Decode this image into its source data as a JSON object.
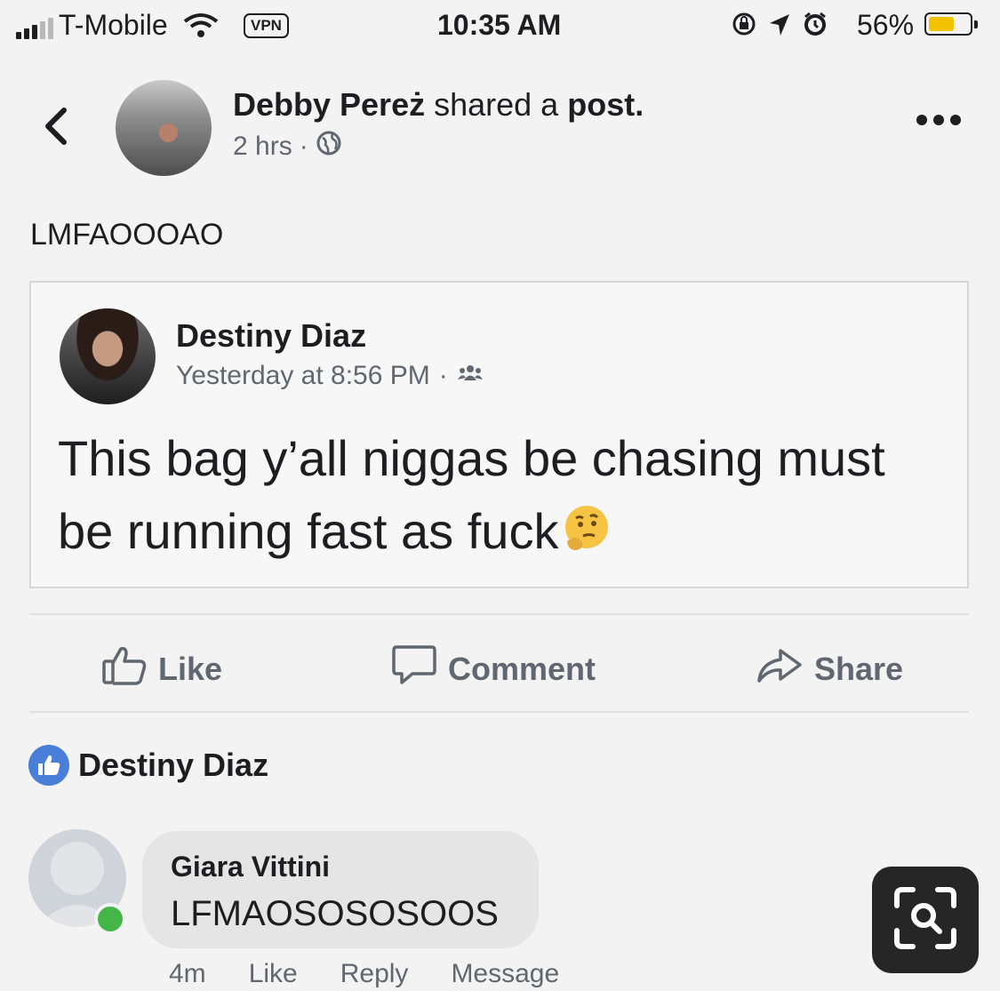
{
  "status_bar": {
    "carrier": "T-Mobile",
    "vpn": "VPN",
    "time": "10:35 AM",
    "battery_percent": "56%",
    "battery_level": 0.56,
    "icons": [
      "signal-icon",
      "wifi-icon",
      "rotation-lock-icon",
      "location-icon",
      "alarm-icon",
      "battery-icon"
    ]
  },
  "post": {
    "author": "Debby Pereż",
    "action_text": "shared a",
    "action_object": "post.",
    "time": "2 hrs",
    "privacy_icon": "globe-icon",
    "text": "LMFAOOOAO"
  },
  "shared_post": {
    "author": "Destiny Diaz",
    "time": "Yesterday at 8:56 PM",
    "privacy_icon": "friends-icon",
    "text": "This bag y’all niggas be chasing must be running fast as fuck",
    "emoji": "thinking-face-emoji"
  },
  "actions": {
    "like": "Like",
    "comment": "Comment",
    "share": "Share"
  },
  "reactions": {
    "liked_by": "Destiny Diaz",
    "colors": {
      "like_blue": "#4a7fd9",
      "online_green": "#44b649"
    }
  },
  "comment": {
    "author": "Giara Vittini",
    "text": "LFMAOSOSOSOOS",
    "time": "4m",
    "like": "Like",
    "reply": "Reply",
    "message": "Message"
  }
}
